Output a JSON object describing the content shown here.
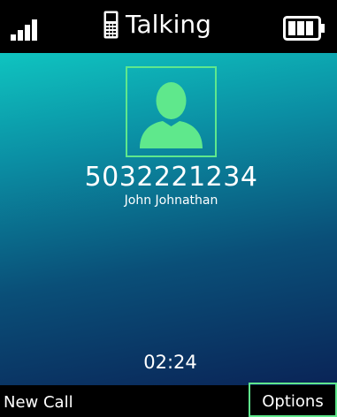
{
  "status_bar": {
    "title": "Talking",
    "signal_icon": "signal-strength-icon",
    "phone_icon": "handset-icon",
    "battery_icon": "battery-icon"
  },
  "call": {
    "avatar_icon": "contact-silhouette-icon",
    "number": "5032221234",
    "name": "John Johnathan",
    "timer": "02:24"
  },
  "softkeys": {
    "left": "New Call",
    "right": "Options"
  },
  "colors": {
    "accent": "#5fe88c",
    "gradient_top": "#0fc4c0",
    "gradient_bottom": "#0a2457",
    "bars": "#000000"
  }
}
